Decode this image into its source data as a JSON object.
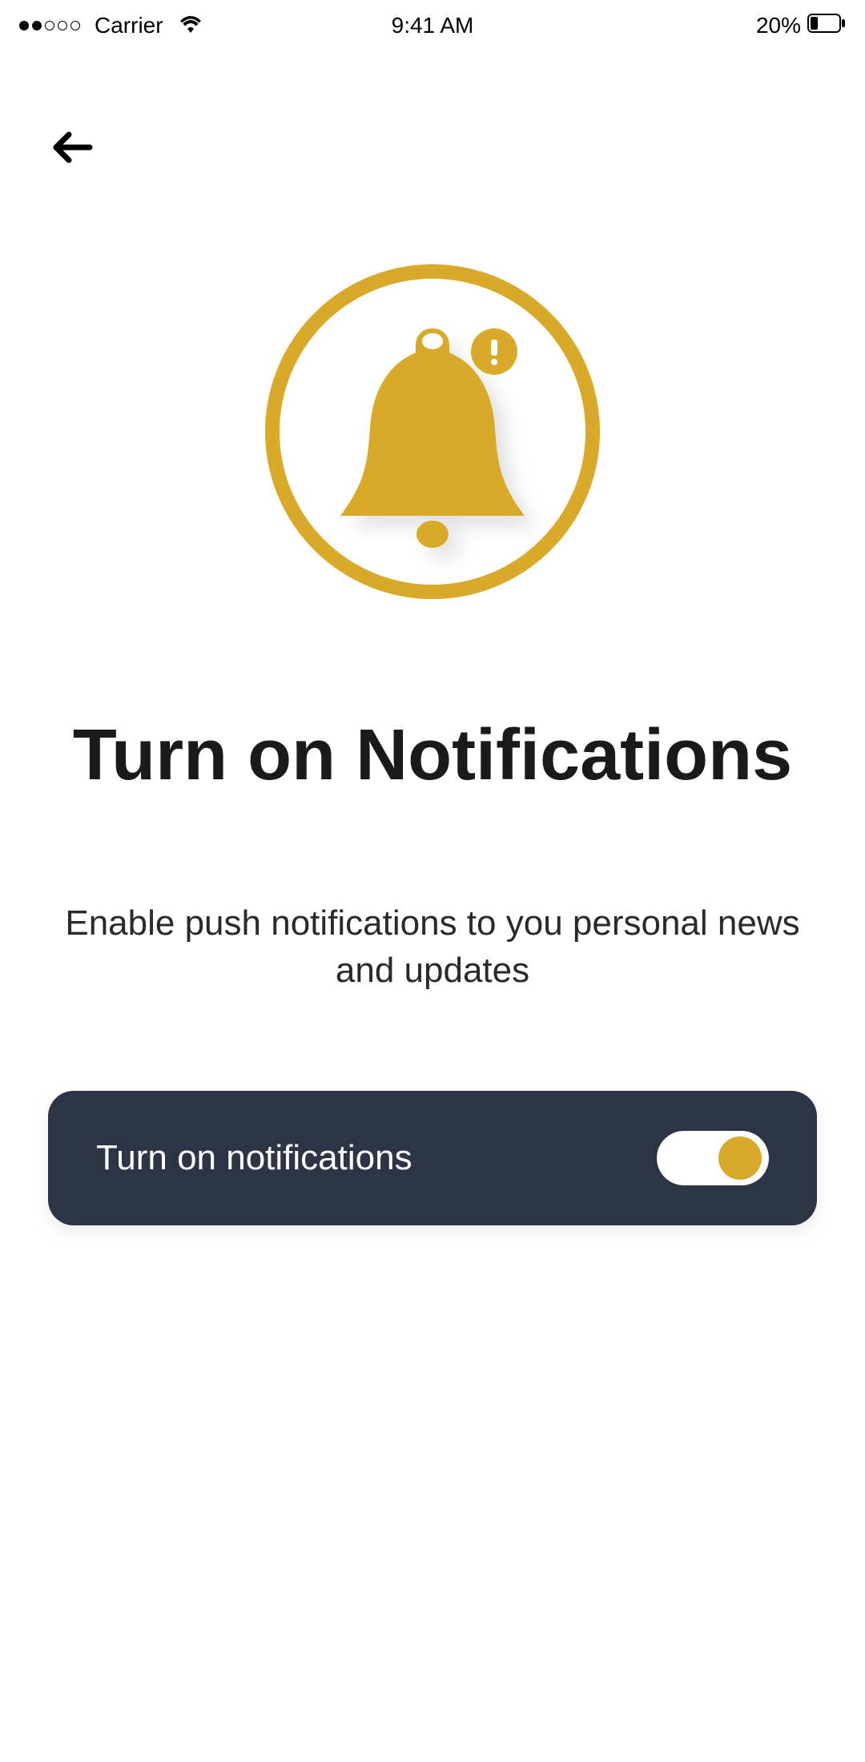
{
  "status_bar": {
    "carrier": "Carrier",
    "time": "9:41 AM",
    "battery_percent": "20%"
  },
  "main": {
    "title": "Turn on Notifications",
    "subtitle": "Enable push notifications to you  personal news and updates"
  },
  "toggle": {
    "label": "Turn on notifications",
    "state": "on"
  },
  "colors": {
    "accent": "#d9a929",
    "card_bg": "#2d3446"
  },
  "icons": {
    "back": "arrow-left-icon",
    "bell": "bell-notification-icon",
    "wifi": "wifi-icon",
    "battery": "battery-icon"
  }
}
